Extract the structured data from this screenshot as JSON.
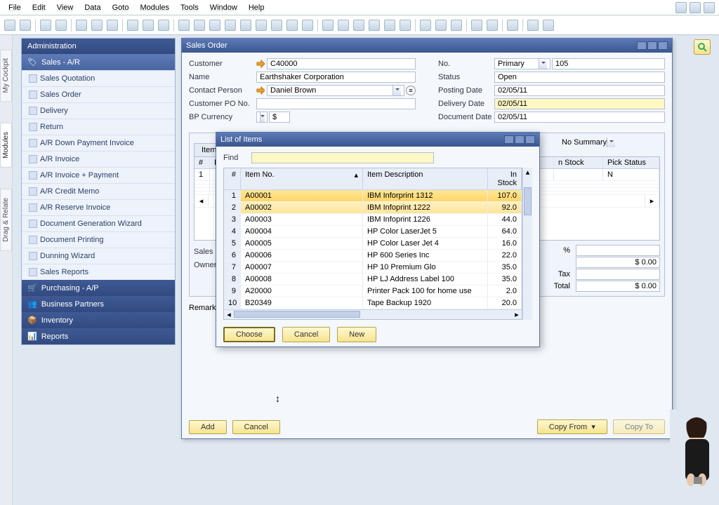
{
  "menu": [
    "File",
    "Edit",
    "View",
    "Data",
    "Goto",
    "Modules",
    "Tools",
    "Window",
    "Help"
  ],
  "side_tabs": [
    "My Cockpit",
    "Modules",
    "Drag & Relate"
  ],
  "nav": {
    "administration": "Administration",
    "sales_ar": "Sales - A/R",
    "items": [
      "Sales Quotation",
      "Sales Order",
      "Delivery",
      "Return",
      "A/R Down Payment Invoice",
      "A/R Invoice",
      "A/R Invoice + Payment",
      "A/R Credit Memo",
      "A/R Reserve Invoice",
      "Document Generation Wizard",
      "Document Printing",
      "Dunning Wizard",
      "Sales Reports"
    ],
    "purchasing": "Purchasing - A/P",
    "bp": "Business Partners",
    "inventory": "Inventory",
    "reports": "Reports"
  },
  "sales_order": {
    "title": "Sales Order",
    "customer_label": "Customer",
    "customer": "C40000",
    "name_label": "Name",
    "name": "Earthshaker Corporation",
    "contact_label": "Contact Person",
    "contact": "Daniel Brown",
    "pono_label": "Customer PO No.",
    "pono": "",
    "bpcur_label": "BP Currency",
    "bpcur": "$",
    "no_label": "No.",
    "no_type": "Primary",
    "no": "105",
    "status_label": "Status",
    "status": "Open",
    "posting_label": "Posting Date",
    "posting": "02/05/11",
    "delivery_label": "Delivery Date",
    "delivery": "02/05/11",
    "doc_label": "Document Date",
    "doc": "02/05/11",
    "tab": "Item/Se",
    "summary": "No Summary",
    "grid_cols": [
      "#",
      "Ite",
      "n Stock",
      "Pick Status"
    ],
    "grid_pick": "N",
    "sales_emp": "Sales Emp",
    "owner": "Owner",
    "pct": "%",
    "tax": "Tax",
    "total": "Total",
    "amount": "$ 0.00",
    "remarks": "Remarks",
    "add": "Add",
    "cancel": "Cancel",
    "copyfrom": "Copy From",
    "copyto": "Copy To"
  },
  "list_of_items": {
    "title": "List of Items",
    "find_label": "Find",
    "find": "",
    "cols": [
      "#",
      "Item No.",
      "Item Description",
      "In Stock"
    ],
    "rows": [
      {
        "n": 1,
        "no": "A00001",
        "desc": "IBM Inforprint 1312",
        "stock": "107.0"
      },
      {
        "n": 2,
        "no": "A00002",
        "desc": "IBM Infoprint 1222",
        "stock": "92.0"
      },
      {
        "n": 3,
        "no": "A00003",
        "desc": "IBM Infoprint 1226",
        "stock": "44.0"
      },
      {
        "n": 4,
        "no": "A00004",
        "desc": "HP Color LaserJet 5",
        "stock": "64.0"
      },
      {
        "n": 5,
        "no": "A00005",
        "desc": "HP Color Laser Jet 4",
        "stock": "16.0"
      },
      {
        "n": 6,
        "no": "A00006",
        "desc": "HP 600 Series Inc",
        "stock": "22.0"
      },
      {
        "n": 7,
        "no": "A00007",
        "desc": "HP 10 Premium Glo",
        "stock": "35.0"
      },
      {
        "n": 8,
        "no": "A00008",
        "desc": "HP LJ Address Label 100",
        "stock": "35.0"
      },
      {
        "n": 9,
        "no": "A20000",
        "desc": "Printer Pack 100 for home use",
        "stock": "2.0"
      },
      {
        "n": 10,
        "no": "B20349",
        "desc": "Tape Backup 1920",
        "stock": "20.0"
      }
    ],
    "choose": "Choose",
    "cancel": "Cancel",
    "new": "New"
  }
}
